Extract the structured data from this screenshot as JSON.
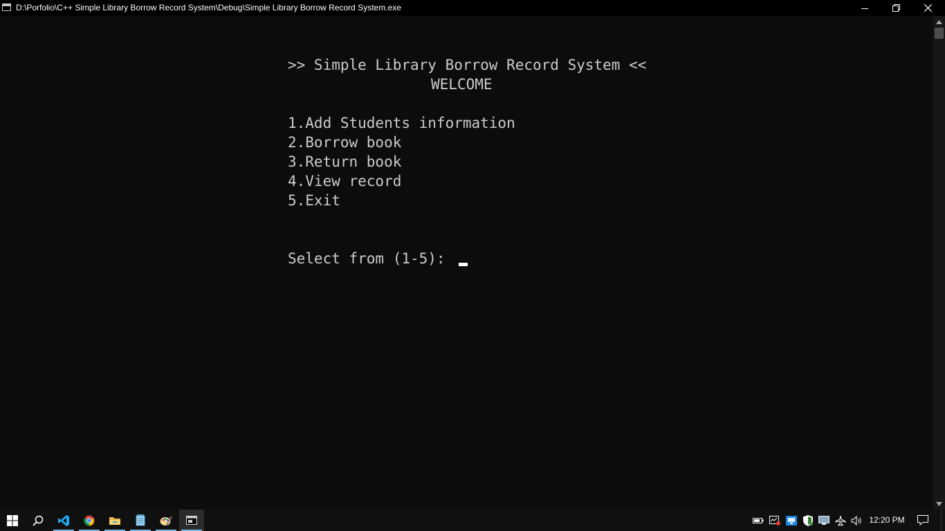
{
  "window": {
    "title": "D:\\Porfolio\\C++ Simple Library Borrow Record System\\Debug\\Simple Library Borrow Record System.exe"
  },
  "console": {
    "header": ">> Simple Library Borrow Record System <<",
    "welcome": "WELCOME",
    "menu": [
      "1.Add Students information",
      "2.Borrow book",
      "3.Return book",
      "4.View record",
      "5.Exit"
    ],
    "prompt": "Select from (1-5): "
  },
  "taskbar": {
    "apps": [
      "start-icon",
      "search-icon",
      "vscode-icon",
      "chrome-icon",
      "file-explorer-icon",
      "notepad-icon",
      "paint-icon",
      "console-icon"
    ],
    "tray": [
      "battery-icon",
      "task-manager-icon",
      "network-icon",
      "defender-icon",
      "display-icon",
      "airplane-mode-icon",
      "volume-icon"
    ],
    "clock": "12:20 PM"
  }
}
